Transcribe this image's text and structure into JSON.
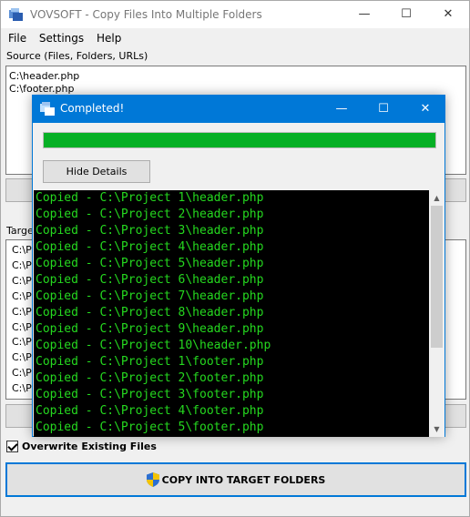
{
  "window": {
    "title": "VOVSOFT - Copy Files Into Multiple Folders",
    "minimize": "—",
    "maximize": "☐",
    "close": "✕"
  },
  "menu": [
    "File",
    "Settings",
    "Help"
  ],
  "source": {
    "label": "Source (Files, Folders, URLs)",
    "items": [
      "C:\\header.php",
      "C:\\footer.php"
    ]
  },
  "target": {
    "label": "Targe",
    "items": [
      "C:\\P",
      "C:\\P",
      "C:\\P",
      "C:\\P",
      "C:\\P",
      "C:\\P",
      "C:\\P",
      "C:\\P",
      "C:\\P",
      "C:\\P"
    ]
  },
  "overwrite": {
    "label": "Overwrite Existing Files",
    "checked": true
  },
  "copy_button": {
    "label": "COPY INTO TARGET FOLDERS",
    "icon": "uac-shield-icon"
  },
  "dialog": {
    "title": "Completed!",
    "progress": 1.0,
    "minimize": "—",
    "maximize": "☐",
    "close": "✕",
    "hide_details_label": "Hide Details",
    "log": [
      "Copied - C:\\Project 1\\header.php",
      "Copied - C:\\Project 2\\header.php",
      "Copied - C:\\Project 3\\header.php",
      "Copied - C:\\Project 4\\header.php",
      "Copied - C:\\Project 5\\header.php",
      "Copied - C:\\Project 6\\header.php",
      "Copied - C:\\Project 7\\header.php",
      "Copied - C:\\Project 8\\header.php",
      "Copied - C:\\Project 9\\header.php",
      "Copied - C:\\Project 10\\header.php",
      "Copied - C:\\Project 1\\footer.php",
      "Copied - C:\\Project 2\\footer.php",
      "Copied - C:\\Project 3\\footer.php",
      "Copied - C:\\Project 4\\footer.php",
      "Copied - C:\\Project 5\\footer.php"
    ]
  },
  "colors": {
    "accent": "#0078d7",
    "progress": "#06b025",
    "log_text": "#25d81f",
    "log_bg": "#000000"
  }
}
